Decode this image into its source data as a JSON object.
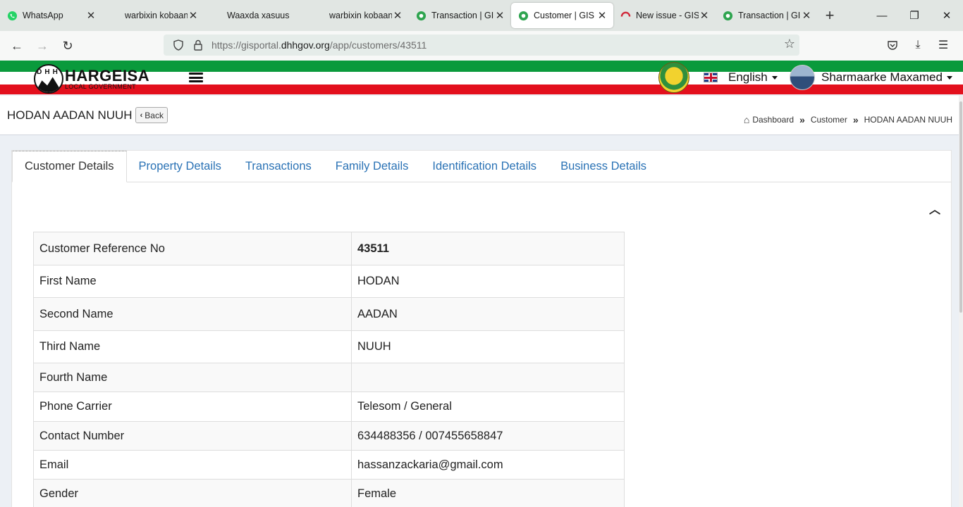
{
  "browser": {
    "tabs": [
      {
        "title": "WhatsApp",
        "icon": "whatsapp-icon",
        "active": false
      },
      {
        "title": "warbixin kobaan.pdf",
        "icon": "pdf-icon",
        "active": false
      },
      {
        "title": "Waaxda xasuus reeb",
        "icon": "pdf-icon",
        "active": false
      },
      {
        "title": "warbixin kobaan.pdf",
        "icon": "pdf-icon",
        "active": false
      },
      {
        "title": "Transaction | GIS",
        "icon": "gis-icon",
        "active": false
      },
      {
        "title": "Customer | GIS P",
        "icon": "gis-icon",
        "active": true
      },
      {
        "title": "New issue - GIS-",
        "icon": "gitlab-icon",
        "active": false
      },
      {
        "title": "Transaction | GIS",
        "icon": "gis-icon",
        "active": false
      }
    ],
    "url_prefix": "https://gisportal.",
    "url_domain": "dhhgov.org",
    "url_path": "/app/customers/43511"
  },
  "header": {
    "logo_title": "HARGEISA",
    "logo_subtitle": "LOCAL GOVERNMENT",
    "logo_letters": "DHH",
    "language": "English",
    "user_name": "Sharmaarke Maxamed"
  },
  "page": {
    "title": "HODAN AADAN NUUH",
    "back_label": "Back",
    "breadcrumb": [
      "Dashboard",
      "Customer",
      "HODAN AADAN NUUH"
    ]
  },
  "tabs": [
    "Customer Details",
    "Property Details",
    "Transactions",
    "Family Details",
    "Identification Details",
    "Business Details"
  ],
  "details": [
    {
      "label": "Customer Reference No",
      "value": "43511"
    },
    {
      "label": "First Name",
      "value": "HODAN"
    },
    {
      "label": "Second Name",
      "value": "AADAN"
    },
    {
      "label": "Third Name",
      "value": "NUUH"
    },
    {
      "label": "Fourth Name",
      "value": ""
    },
    {
      "label": "Phone Carrier",
      "value": "Telesom / General"
    },
    {
      "label": "Contact Number",
      "value": "634488356 / 007455658847"
    },
    {
      "label": "Email",
      "value": "hassanzackaria@gmail.com"
    },
    {
      "label": "Gender",
      "value": "Female"
    }
  ]
}
